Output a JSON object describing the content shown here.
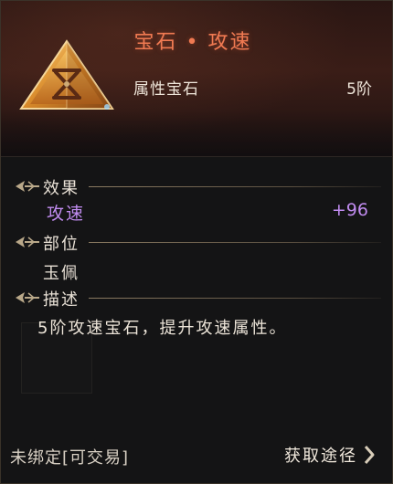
{
  "item": {
    "title": "宝石 • 攻速",
    "type_label": "属性宝石",
    "tier": "5阶"
  },
  "sections": {
    "effect": {
      "heading": "效果",
      "stat_name": "攻速",
      "stat_value": "+96"
    },
    "slot": {
      "heading": "部位",
      "value": "玉佩"
    },
    "description": {
      "heading": "描述",
      "text": "5阶攻速宝石，提升攻速属性。"
    }
  },
  "footer": {
    "bind_status": "未绑定[可交易]",
    "obtain_label": "获取途径"
  },
  "colors": {
    "title": "#f07a52",
    "stat": "#c18cf0",
    "text": "#e9e1d6",
    "gem_gold": "#e9a23b"
  },
  "icons": {
    "gem": "triangle-gem-hourglass-icon",
    "section_marker": "ornate-arrow-icon",
    "obtain": "chevron-right-icon"
  }
}
